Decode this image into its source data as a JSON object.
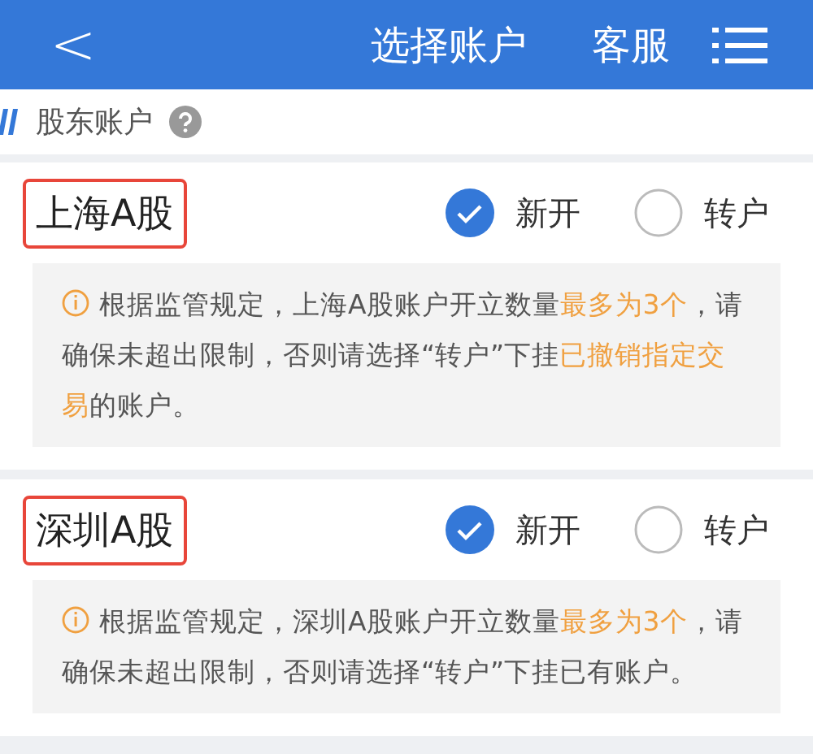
{
  "header": {
    "back": "<",
    "title": "选择账户",
    "service": "客服"
  },
  "section": {
    "title": "股东账户"
  },
  "accounts": [
    {
      "name": "上海A股",
      "highlighted": true,
      "options": [
        {
          "label": "新开",
          "selected": true
        },
        {
          "label": "转户",
          "selected": false
        }
      ],
      "note": [
        {
          "text": "根据监管规定，上海A股账户开立数量",
          "emphasis": false
        },
        {
          "text": "最多为3个",
          "emphasis": true
        },
        {
          "text": "，请确保未超出限制，否则请选择“转户”下挂",
          "emphasis": false
        },
        {
          "text": "已撤销指定交易",
          "emphasis": true
        },
        {
          "text": "的账户。",
          "emphasis": false
        }
      ]
    },
    {
      "name": "深圳A股",
      "highlighted": true,
      "options": [
        {
          "label": "新开",
          "selected": true
        },
        {
          "label": "转户",
          "selected": false
        }
      ],
      "note": [
        {
          "text": "根据监管规定，深圳A股账户开立数量",
          "emphasis": false
        },
        {
          "text": "最多为3个",
          "emphasis": true
        },
        {
          "text": "，请确保未超出限制，否则请选择“转户”下挂已有账户。",
          "emphasis": false
        }
      ]
    }
  ]
}
